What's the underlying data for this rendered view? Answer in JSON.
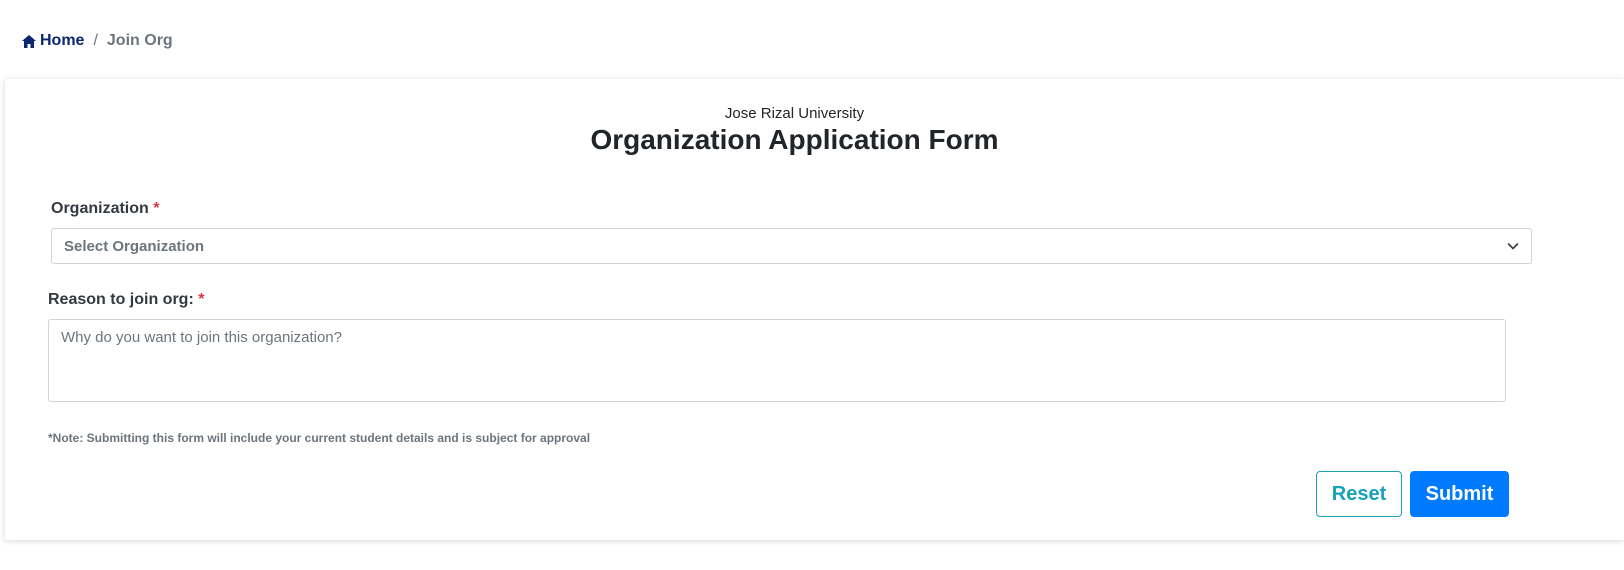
{
  "breadcrumb": {
    "home_label": "Home",
    "home_icon": "home-icon",
    "separator": "/",
    "current_label": "Join Org"
  },
  "form": {
    "university": "Jose Rizal University",
    "title": "Organization Application Form",
    "organization": {
      "label": "Organization",
      "required_marker": "*",
      "selected_value": "Select Organization",
      "icon": "chevron-down-icon"
    },
    "reason": {
      "label": "Reason to join org:",
      "required_marker": "*",
      "placeholder": "Why do you want to join this organization?",
      "value": ""
    },
    "note": "*Note: Submitting this form will include your current student details and is subject for approval",
    "reset_label": "Reset",
    "submit_label": "Submit"
  },
  "colors": {
    "home_link": "#0b2670",
    "required": "#dc3545",
    "reset_button": "#17a2b8",
    "submit_button": "#007bff"
  }
}
